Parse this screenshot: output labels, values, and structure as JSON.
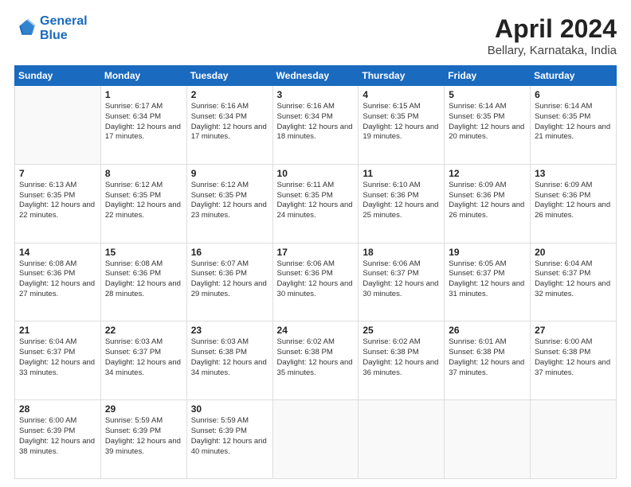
{
  "logo": {
    "line1": "General",
    "line2": "Blue"
  },
  "title": "April 2024",
  "subtitle": "Bellary, Karnataka, India",
  "headers": [
    "Sunday",
    "Monday",
    "Tuesday",
    "Wednesday",
    "Thursday",
    "Friday",
    "Saturday"
  ],
  "weeks": [
    [
      {
        "day": "",
        "sunrise": "",
        "sunset": "",
        "daylight": ""
      },
      {
        "day": "1",
        "sunrise": "Sunrise: 6:17 AM",
        "sunset": "Sunset: 6:34 PM",
        "daylight": "Daylight: 12 hours and 17 minutes."
      },
      {
        "day": "2",
        "sunrise": "Sunrise: 6:16 AM",
        "sunset": "Sunset: 6:34 PM",
        "daylight": "Daylight: 12 hours and 17 minutes."
      },
      {
        "day": "3",
        "sunrise": "Sunrise: 6:16 AM",
        "sunset": "Sunset: 6:34 PM",
        "daylight": "Daylight: 12 hours and 18 minutes."
      },
      {
        "day": "4",
        "sunrise": "Sunrise: 6:15 AM",
        "sunset": "Sunset: 6:35 PM",
        "daylight": "Daylight: 12 hours and 19 minutes."
      },
      {
        "day": "5",
        "sunrise": "Sunrise: 6:14 AM",
        "sunset": "Sunset: 6:35 PM",
        "daylight": "Daylight: 12 hours and 20 minutes."
      },
      {
        "day": "6",
        "sunrise": "Sunrise: 6:14 AM",
        "sunset": "Sunset: 6:35 PM",
        "daylight": "Daylight: 12 hours and 21 minutes."
      }
    ],
    [
      {
        "day": "7",
        "sunrise": "Sunrise: 6:13 AM",
        "sunset": "Sunset: 6:35 PM",
        "daylight": "Daylight: 12 hours and 22 minutes."
      },
      {
        "day": "8",
        "sunrise": "Sunrise: 6:12 AM",
        "sunset": "Sunset: 6:35 PM",
        "daylight": "Daylight: 12 hours and 22 minutes."
      },
      {
        "day": "9",
        "sunrise": "Sunrise: 6:12 AM",
        "sunset": "Sunset: 6:35 PM",
        "daylight": "Daylight: 12 hours and 23 minutes."
      },
      {
        "day": "10",
        "sunrise": "Sunrise: 6:11 AM",
        "sunset": "Sunset: 6:35 PM",
        "daylight": "Daylight: 12 hours and 24 minutes."
      },
      {
        "day": "11",
        "sunrise": "Sunrise: 6:10 AM",
        "sunset": "Sunset: 6:36 PM",
        "daylight": "Daylight: 12 hours and 25 minutes."
      },
      {
        "day": "12",
        "sunrise": "Sunrise: 6:09 AM",
        "sunset": "Sunset: 6:36 PM",
        "daylight": "Daylight: 12 hours and 26 minutes."
      },
      {
        "day": "13",
        "sunrise": "Sunrise: 6:09 AM",
        "sunset": "Sunset: 6:36 PM",
        "daylight": "Daylight: 12 hours and 26 minutes."
      }
    ],
    [
      {
        "day": "14",
        "sunrise": "Sunrise: 6:08 AM",
        "sunset": "Sunset: 6:36 PM",
        "daylight": "Daylight: 12 hours and 27 minutes."
      },
      {
        "day": "15",
        "sunrise": "Sunrise: 6:08 AM",
        "sunset": "Sunset: 6:36 PM",
        "daylight": "Daylight: 12 hours and 28 minutes."
      },
      {
        "day": "16",
        "sunrise": "Sunrise: 6:07 AM",
        "sunset": "Sunset: 6:36 PM",
        "daylight": "Daylight: 12 hours and 29 minutes."
      },
      {
        "day": "17",
        "sunrise": "Sunrise: 6:06 AM",
        "sunset": "Sunset: 6:36 PM",
        "daylight": "Daylight: 12 hours and 30 minutes."
      },
      {
        "day": "18",
        "sunrise": "Sunrise: 6:06 AM",
        "sunset": "Sunset: 6:37 PM",
        "daylight": "Daylight: 12 hours and 30 minutes."
      },
      {
        "day": "19",
        "sunrise": "Sunrise: 6:05 AM",
        "sunset": "Sunset: 6:37 PM",
        "daylight": "Daylight: 12 hours and 31 minutes."
      },
      {
        "day": "20",
        "sunrise": "Sunrise: 6:04 AM",
        "sunset": "Sunset: 6:37 PM",
        "daylight": "Daylight: 12 hours and 32 minutes."
      }
    ],
    [
      {
        "day": "21",
        "sunrise": "Sunrise: 6:04 AM",
        "sunset": "Sunset: 6:37 PM",
        "daylight": "Daylight: 12 hours and 33 minutes."
      },
      {
        "day": "22",
        "sunrise": "Sunrise: 6:03 AM",
        "sunset": "Sunset: 6:37 PM",
        "daylight": "Daylight: 12 hours and 34 minutes."
      },
      {
        "day": "23",
        "sunrise": "Sunrise: 6:03 AM",
        "sunset": "Sunset: 6:38 PM",
        "daylight": "Daylight: 12 hours and 34 minutes."
      },
      {
        "day": "24",
        "sunrise": "Sunrise: 6:02 AM",
        "sunset": "Sunset: 6:38 PM",
        "daylight": "Daylight: 12 hours and 35 minutes."
      },
      {
        "day": "25",
        "sunrise": "Sunrise: 6:02 AM",
        "sunset": "Sunset: 6:38 PM",
        "daylight": "Daylight: 12 hours and 36 minutes."
      },
      {
        "day": "26",
        "sunrise": "Sunrise: 6:01 AM",
        "sunset": "Sunset: 6:38 PM",
        "daylight": "Daylight: 12 hours and 37 minutes."
      },
      {
        "day": "27",
        "sunrise": "Sunrise: 6:00 AM",
        "sunset": "Sunset: 6:38 PM",
        "daylight": "Daylight: 12 hours and 37 minutes."
      }
    ],
    [
      {
        "day": "28",
        "sunrise": "Sunrise: 6:00 AM",
        "sunset": "Sunset: 6:39 PM",
        "daylight": "Daylight: 12 hours and 38 minutes."
      },
      {
        "day": "29",
        "sunrise": "Sunrise: 5:59 AM",
        "sunset": "Sunset: 6:39 PM",
        "daylight": "Daylight: 12 hours and 39 minutes."
      },
      {
        "day": "30",
        "sunrise": "Sunrise: 5:59 AM",
        "sunset": "Sunset: 6:39 PM",
        "daylight": "Daylight: 12 hours and 40 minutes."
      },
      {
        "day": "",
        "sunrise": "",
        "sunset": "",
        "daylight": ""
      },
      {
        "day": "",
        "sunrise": "",
        "sunset": "",
        "daylight": ""
      },
      {
        "day": "",
        "sunrise": "",
        "sunset": "",
        "daylight": ""
      },
      {
        "day": "",
        "sunrise": "",
        "sunset": "",
        "daylight": ""
      }
    ]
  ]
}
